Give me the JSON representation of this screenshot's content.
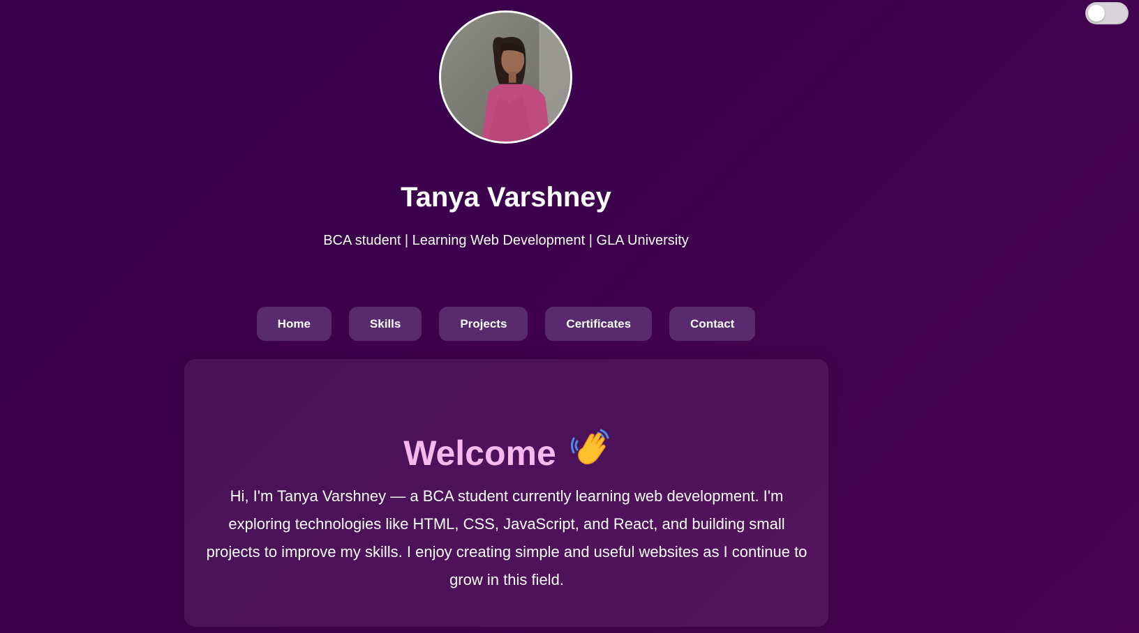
{
  "header": {
    "theme_toggle": {
      "state": "off"
    },
    "avatar": {
      "alt": "Tanya Varshney profile photo"
    },
    "name": "Tanya Varshney",
    "subtitle": "BCA student | Learning Web Development | GLA University"
  },
  "nav": {
    "items": [
      {
        "label": "Home"
      },
      {
        "label": "Skills"
      },
      {
        "label": "Projects"
      },
      {
        "label": "Certificates"
      },
      {
        "label": "Contact"
      }
    ]
  },
  "welcome": {
    "title": "Welcome",
    "icon": "waving-hand-icon",
    "text": "Hi, I'm Tanya Varshney — a BCA student currently learning web development. I'm exploring technologies like HTML, CSS, JavaScript, and React, and building small projects to improve my skills. I enjoy creating simple and useful websites as I continue to grow in this field."
  },
  "colors": {
    "background": "#3d004d",
    "accent": "#f7b8ee",
    "button": "#5a2a6e",
    "toggle": "#d9d4d9"
  }
}
